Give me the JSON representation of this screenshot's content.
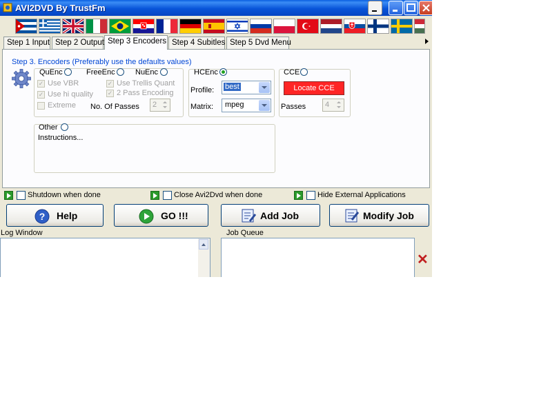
{
  "window": {
    "title": "AVI2DVD By TrustFm"
  },
  "flags": [
    "cuba",
    "greece",
    "united-kingdom",
    "italy",
    "brazil",
    "croatia",
    "france",
    "germany",
    "spain",
    "israel",
    "russia",
    "poland",
    "turkey",
    "netherlands",
    "slovakia",
    "finland",
    "sweden",
    "hungary"
  ],
  "tabs": [
    "Step 1 Input",
    "Step 2 Output",
    "Step 3 Encoders",
    "Step 4 Subitles",
    "Step 5 Dvd Menu"
  ],
  "active_tab": "Step 3 Encoders",
  "encoders": {
    "step_label": "Step 3. Encoders (Preferably use the defaults values)",
    "quenc": "QuEnc",
    "freeenc": "FreeEnc",
    "nuenc": "NuEnc",
    "use_vbr": "Use VBR",
    "use_hi_quality": "Use hi quality",
    "extreme": "Extreme",
    "use_trellis_quant": "Use Trellis Quant",
    "two_pass_encoding": "2 Pass Encoding",
    "no_of_passes_label": "No. Of Passes",
    "no_of_passes_value": "2",
    "hcenc": "HCEnc",
    "profile_label": "Profile:",
    "profile_value": "best",
    "matrix_label": "Matrix:",
    "matrix_value": "mpeg",
    "cce": "CCE",
    "locate_cce": "Locate CCE",
    "passes_label": "Passes",
    "passes_value": "4",
    "other": "Other",
    "instructions": "Instructions..."
  },
  "options": {
    "shutdown": "Shutdown when done",
    "close_app": "Close Avi2Dvd when done",
    "hide_external": "Hide External Applications"
  },
  "buttons": {
    "help": "Help",
    "go": "GO !!!",
    "add_job": "Add Job",
    "modify_job": "Modify Job"
  },
  "panes": {
    "log_window": "Log Window",
    "job_queue": "Job Queue"
  },
  "colors": {
    "title_bar": "#0a5fe0",
    "locate_button": "#ff0000",
    "step_label": "#0046d5",
    "selected_radio": "#21a121"
  }
}
